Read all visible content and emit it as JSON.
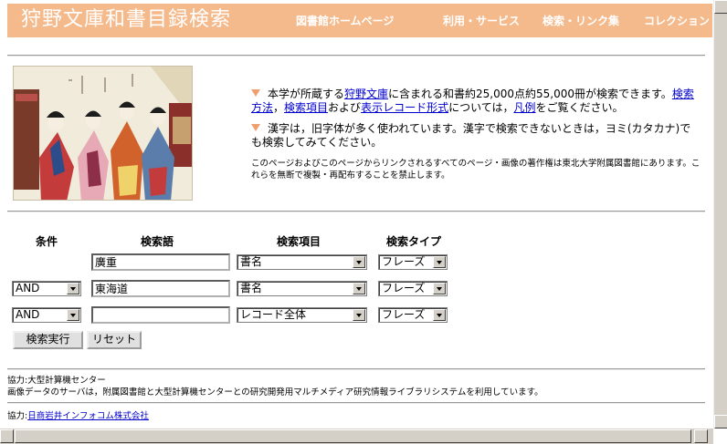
{
  "header": {
    "title": "狩野文庫和書目録検索",
    "nav": [
      "図書館ホームページ",
      "利用・サービス",
      "検索・リンク集",
      "コレクション"
    ]
  },
  "intro": {
    "p1_pre": "本学が所蔵する",
    "p1_link1": "狩野文庫",
    "p1_mid": "に含まれる和書約25,000点約55,000冊が検索できます。",
    "p1_link2": "検索方法",
    "p1_sep1": "，",
    "p1_link3": "検索項目",
    "p1_and": "および",
    "p1_link4": "表示レコード形式",
    "p1_mid2": "については，",
    "p1_link5": "凡例",
    "p1_end": "をご覧ください。",
    "p2": "漢字は，旧字体が多く使われています。漢字で検索できないときは，ヨミ(カタカナ)でも検索してみてください。",
    "copyright": "このページおよびこのページからリンクされるすべてのページ・画像の著作権は東北大学附属図書館にあります。これらを無断で複製・再配布することを禁止します。"
  },
  "form": {
    "headers": {
      "condition": "条件",
      "term": "検索語",
      "field": "検索項目",
      "type": "検索タイプ"
    },
    "rows": [
      {
        "condition": "",
        "term": "廣重",
        "field": "書名",
        "type": "フレーズ"
      },
      {
        "condition": "AND",
        "term": "東海道",
        "field": "書名",
        "type": "フレーズ"
      },
      {
        "condition": "AND",
        "term": "",
        "field": "レコード全体",
        "type": "フレーズ"
      }
    ],
    "submit_label": "検索実行",
    "reset_label": "リセット"
  },
  "footer": {
    "line1": "協力:大型計算機センター",
    "line2": "画像データのサーバは，附属図書館と大型計算機センターとの研究開発用マルチメディア研究情報ライブラリシステムを利用しています。",
    "line3_prefix": "協力:",
    "line3_link": "日商岩井インフォコム株式会社"
  },
  "colors": {
    "header_bg": "#f5ba8c",
    "link": "#0000cc",
    "bullet": "#f0a070"
  }
}
